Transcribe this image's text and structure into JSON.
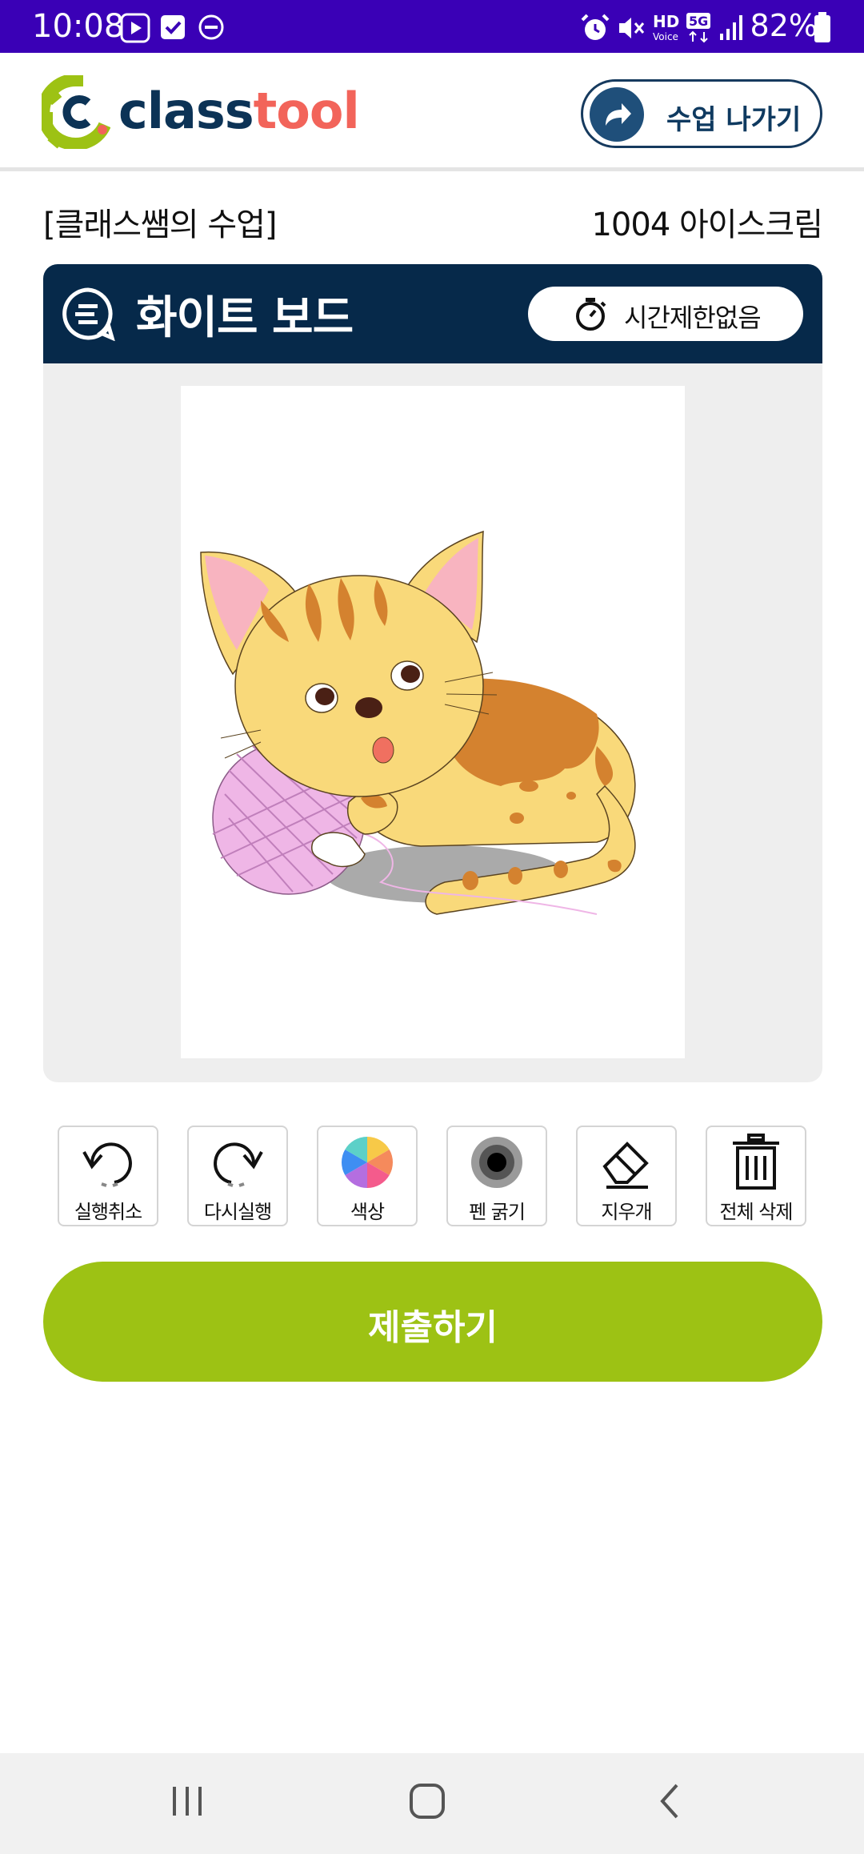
{
  "status_bar": {
    "time": "10:08",
    "battery": "82%",
    "icons": [
      "youtube-icon",
      "checkbox-icon",
      "dnd-icon",
      "alarm-icon",
      "mute-icon",
      "hd-voice-icon",
      "5g-icon",
      "signal-icon",
      "battery-icon"
    ]
  },
  "header": {
    "logo_part1": "class",
    "logo_part2": "tool",
    "exit_button": "수업 나가기"
  },
  "class_info": {
    "class_name": "[클래스쌤의 수업]",
    "student": "1004 아이스크림"
  },
  "board": {
    "title": "화이트 보드",
    "timer": "시간제한없음"
  },
  "tools": [
    {
      "label": "실행취소",
      "icon": "undo-icon"
    },
    {
      "label": "다시실행",
      "icon": "redo-icon"
    },
    {
      "label": "색상",
      "icon": "color-wheel-icon"
    },
    {
      "label": "펜 굵기",
      "icon": "pen-thickness-icon"
    },
    {
      "label": "지우개",
      "icon": "eraser-icon"
    },
    {
      "label": "전체 삭제",
      "icon": "trash-icon"
    }
  ],
  "submit": "제출하기",
  "colors": {
    "status_bar": "#3a00b6",
    "brand_navy": "#06294a",
    "brand_green": "#9dc214",
    "logo_coral": "#f2645a"
  }
}
